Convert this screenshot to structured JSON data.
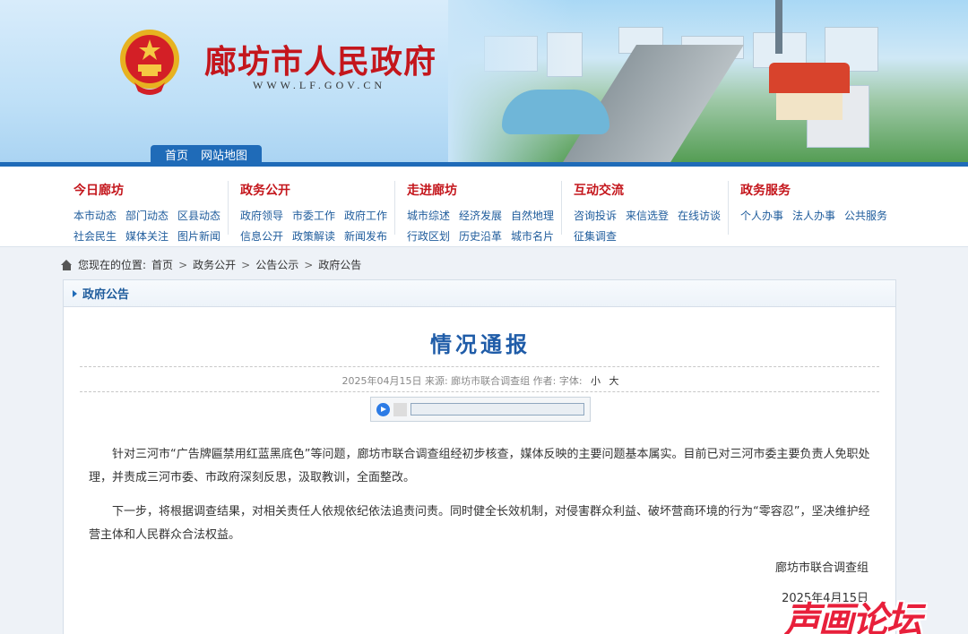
{
  "header": {
    "site_title": "廊坊市人民政府",
    "site_url": "WWW.LF.GOV.CN",
    "tabs": [
      "首页",
      "网站地图"
    ]
  },
  "nav": [
    {
      "title": "今日廊坊",
      "links": [
        "本市动态",
        "部门动态",
        "区县动态",
        "社会民生",
        "媒体关注",
        "图片新闻"
      ]
    },
    {
      "title": "政务公开",
      "links": [
        "政府领导",
        "市委工作",
        "政府工作",
        "信息公开",
        "政策解读",
        "新闻发布"
      ]
    },
    {
      "title": "走进廊坊",
      "links": [
        "城市综述",
        "经济发展",
        "自然地理",
        "行政区划",
        "历史沿革",
        "城市名片"
      ]
    },
    {
      "title": "互动交流",
      "links": [
        "咨询投诉",
        "来信选登",
        "在线访谈",
        "征集调查"
      ]
    },
    {
      "title": "政务服务",
      "links": [
        "个人办事",
        "法人办事",
        "公共服务"
      ]
    }
  ],
  "breadcrumb": {
    "prefix": "您现在的位置:",
    "items": [
      "首页",
      "政务公开",
      "公告公示",
      "政府公告"
    ]
  },
  "section_title": "政府公告",
  "article": {
    "title": "情况通报",
    "meta": "2025年04月15日   来源: 廊坊市联合调查组   作者:   字体:",
    "font_small": "小",
    "font_large": "大",
    "paragraphs": [
      "针对三河市“广告牌匾禁用红蓝黑底色”等问题，廊坊市联合调查组经初步核查，媒体反映的主要问题基本属实。目前已对三河市委主要负责人免职处理，并责成三河市委、市政府深刻反思，汲取教训，全面整改。",
      "下一步，将根据调查结果，对相关责任人依规依纪依法追责问责。同时健全长效机制，对侵害群众利益、破坏营商环境的行为“零容忍”，坚决维护经营主体和人民群众合法权益。"
    ],
    "signature": "廊坊市联合调查组",
    "sign_date": "2025年4月15日"
  },
  "watermark": "声画论坛"
}
